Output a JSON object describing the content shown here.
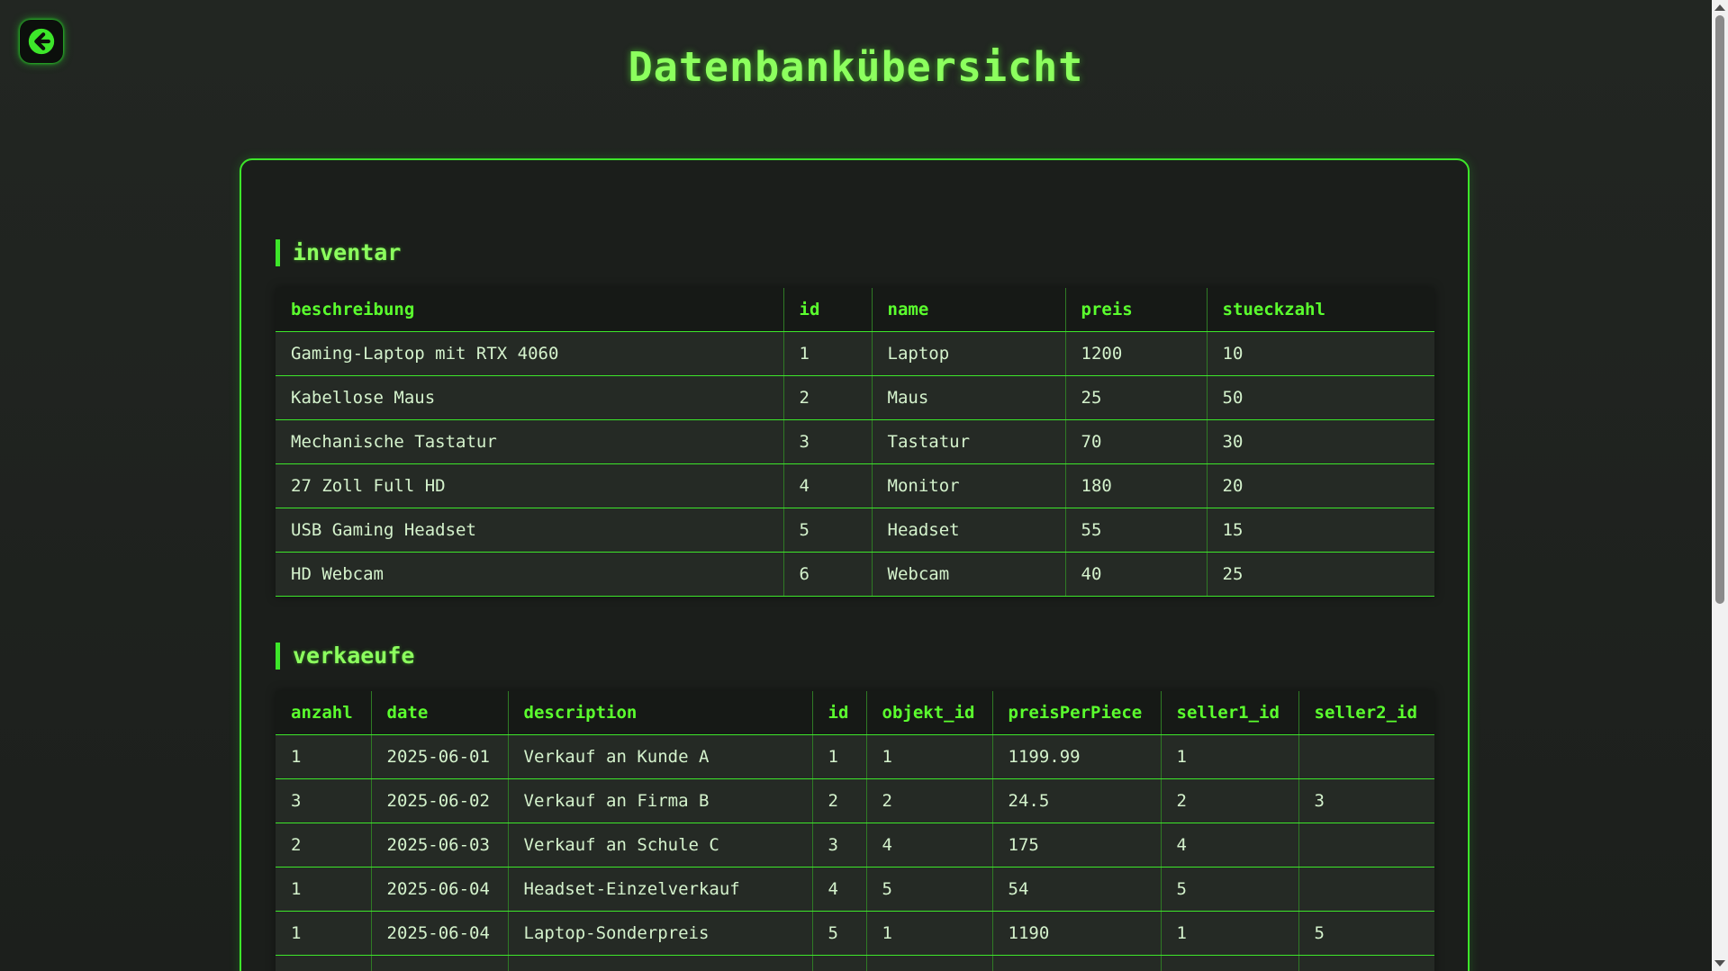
{
  "page": {
    "title": "Datenbankübersicht",
    "back_icon": "arrow-left-icon"
  },
  "colors": {
    "accent": "#3de62a",
    "title": "#8cff5e",
    "header_text": "#5bff2e",
    "background": "#1f221f"
  },
  "inventar": {
    "title": "inventar",
    "columns": [
      "beschreibung",
      "id",
      "name",
      "preis",
      "stueckzahl"
    ],
    "rows": [
      [
        "Gaming-Laptop mit RTX 4060",
        "1",
        "Laptop",
        "1200",
        "10"
      ],
      [
        "Kabellose Maus",
        "2",
        "Maus",
        "25",
        "50"
      ],
      [
        "Mechanische Tastatur",
        "3",
        "Tastatur",
        "70",
        "30"
      ],
      [
        "27 Zoll Full HD",
        "4",
        "Monitor",
        "180",
        "20"
      ],
      [
        "USB Gaming Headset",
        "5",
        "Headset",
        "55",
        "15"
      ],
      [
        "HD Webcam",
        "6",
        "Webcam",
        "40",
        "25"
      ]
    ]
  },
  "verkaeufe": {
    "title": "verkaeufe",
    "columns": [
      "anzahl",
      "date",
      "description",
      "id",
      "objekt_id",
      "preisPerPiece",
      "seller1_id",
      "seller2_id"
    ],
    "rows": [
      [
        "1",
        "2025-06-01",
        "Verkauf an Kunde A",
        "1",
        "1",
        "1199.99",
        "1",
        ""
      ],
      [
        "3",
        "2025-06-02",
        "Verkauf an Firma B",
        "2",
        "2",
        "24.5",
        "2",
        "3"
      ],
      [
        "2",
        "2025-06-03",
        "Verkauf an Schule C",
        "3",
        "4",
        "175",
        "4",
        ""
      ],
      [
        "1",
        "2025-06-04",
        "Headset-Einzelverkauf",
        "4",
        "5",
        "54",
        "5",
        ""
      ],
      [
        "1",
        "2025-06-04",
        "Laptop-Sonderpreis",
        "5",
        "1",
        "1190",
        "1",
        "5"
      ],
      [
        "",
        "",
        "",
        "",
        "",
        "",
        "",
        ""
      ]
    ]
  }
}
